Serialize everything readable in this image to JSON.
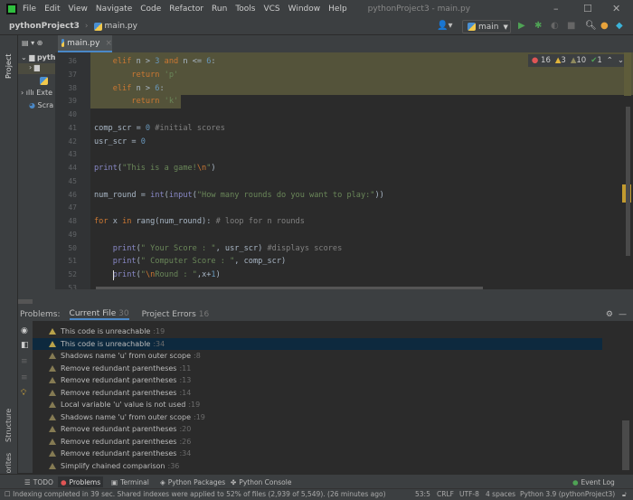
{
  "menu": [
    "File",
    "Edit",
    "View",
    "Navigate",
    "Code",
    "Refactor",
    "Run",
    "Tools",
    "VCS",
    "Window",
    "Help"
  ],
  "window_title": "pythonProject3 - main.py",
  "breadcrumb": {
    "project": "pythonProject3",
    "file": "main.py"
  },
  "run_config": "main",
  "project_pane": {
    "label": "Project",
    "items": [
      "pyth",
      "",
      "",
      "Exte",
      "Scra"
    ]
  },
  "editor_tab": "main.py",
  "inspections": {
    "errors": "16",
    "warnings": "3",
    "weak_warnings": "10",
    "ok": "1"
  },
  "code": [
    {
      "n": "36",
      "t": [
        [
          "    ",
          ""
        ],
        [
          "elif",
          "kw"
        ],
        [
          " n > ",
          ""
        ],
        [
          "3",
          "num"
        ],
        [
          " ",
          ""
        ],
        [
          "and",
          "kw"
        ],
        [
          " n <= ",
          ""
        ],
        [
          "6",
          "num"
        ],
        [
          ":",
          ""
        ]
      ]
    },
    {
      "n": "37",
      "t": [
        [
          "        ",
          ""
        ],
        [
          "return",
          "kw"
        ],
        [
          " ",
          ""
        ],
        [
          "'p'",
          "str"
        ]
      ]
    },
    {
      "n": "38",
      "t": [
        [
          "    ",
          ""
        ],
        [
          "elif",
          "kw"
        ],
        [
          " n > ",
          ""
        ],
        [
          "6",
          "num"
        ],
        [
          ":",
          ""
        ]
      ]
    },
    {
      "n": "39",
      "t": [
        [
          "        ",
          ""
        ],
        [
          "return",
          "kw"
        ],
        [
          " ",
          ""
        ],
        [
          "'k'",
          "str"
        ]
      ]
    },
    {
      "n": "40",
      "t": []
    },
    {
      "n": "41",
      "t": [
        [
          "comp_scr = ",
          ""
        ],
        [
          "0",
          "num"
        ],
        [
          " #initial scores",
          "cm"
        ]
      ]
    },
    {
      "n": "42",
      "t": [
        [
          "usr_scr = ",
          ""
        ],
        [
          "0",
          "num"
        ]
      ]
    },
    {
      "n": "43",
      "t": []
    },
    {
      "n": "44",
      "t": [
        [
          "print",
          "fn"
        ],
        [
          "(",
          ""
        ],
        [
          "\"This is a game!",
          "str"
        ],
        [
          "\\n",
          "esc"
        ],
        [
          "\"",
          "str"
        ],
        [
          ")",
          ""
        ]
      ]
    },
    {
      "n": "45",
      "t": []
    },
    {
      "n": "46",
      "t": [
        [
          "num_round = ",
          ""
        ],
        [
          "int",
          "fn"
        ],
        [
          "(",
          ""
        ],
        [
          "input",
          "fn"
        ],
        [
          "(",
          ""
        ],
        [
          "\"How many rounds do you want to play:\"",
          "str"
        ],
        [
          "))",
          ""
        ]
      ]
    },
    {
      "n": "47",
      "t": []
    },
    {
      "n": "48",
      "t": [
        [
          "for",
          "kw"
        ],
        [
          " x ",
          ""
        ],
        [
          "in",
          "kw"
        ],
        [
          " rang(num_round): ",
          ""
        ],
        [
          "# loop for n rounds",
          "cm"
        ]
      ]
    },
    {
      "n": "49",
      "t": []
    },
    {
      "n": "50",
      "t": [
        [
          "    ",
          ""
        ],
        [
          "print",
          "fn"
        ],
        [
          "(",
          ""
        ],
        [
          "\" Your Score : \"",
          "str"
        ],
        [
          ", usr_scr) ",
          ""
        ],
        [
          "#displays scores",
          "cm"
        ]
      ]
    },
    {
      "n": "51",
      "t": [
        [
          "    ",
          ""
        ],
        [
          "print",
          "fn"
        ],
        [
          "(",
          ""
        ],
        [
          "\" Computer Score : \"",
          "str"
        ],
        [
          ", comp_scr)",
          ""
        ]
      ]
    },
    {
      "n": "52",
      "t": [
        [
          "    ",
          ""
        ],
        [
          "print",
          "fn"
        ],
        [
          "(",
          ""
        ],
        [
          "\"",
          "str"
        ],
        [
          "\\n",
          "esc"
        ],
        [
          "Round : \"",
          "str"
        ],
        [
          ",x+",
          ""
        ],
        [
          "1",
          "num"
        ],
        [
          ")",
          ""
        ]
      ]
    },
    {
      "n": "53",
      "t": []
    }
  ],
  "problems": {
    "label": "Problems:",
    "tabs": [
      {
        "label": "Current File",
        "count": "30"
      },
      {
        "label": "Project Errors",
        "count": "16"
      }
    ],
    "items": [
      {
        "text": "This code is unreachable",
        "line": ":19"
      },
      {
        "text": "This code is unreachable",
        "line": ":34"
      },
      {
        "text": "Shadows name 'u' from outer scope",
        "line": ":8"
      },
      {
        "text": "Remove redundant parentheses",
        "line": ":11"
      },
      {
        "text": "Remove redundant parentheses",
        "line": ":13"
      },
      {
        "text": "Remove redundant parentheses",
        "line": ":14"
      },
      {
        "text": "Local variable 'u' value is not used",
        "line": ":19"
      },
      {
        "text": "Shadows name 'u' from outer scope",
        "line": ":19"
      },
      {
        "text": "Remove redundant parentheses",
        "line": ":20"
      },
      {
        "text": "Remove redundant parentheses",
        "line": ":26"
      },
      {
        "text": "Remove redundant parentheses",
        "line": ":34"
      },
      {
        "text": "Simplify chained comparison",
        "line": ":36"
      }
    ]
  },
  "side_labels": {
    "structure": "Structure",
    "favorites": "Favorites"
  },
  "tool_tabs": [
    "TODO",
    "Problems",
    "Terminal",
    "Python Packages",
    "Python Console"
  ],
  "event_log": "Event Log",
  "status": {
    "message": "Indexing completed in 39 sec. Shared indexes were applied to 52% of files (2,939 of 5,549). (26 minutes ago)",
    "position": "53:5",
    "line_sep": "CRLF",
    "encoding": "UTF-8",
    "indent": "4 spaces",
    "interpreter": "Python 3.9 (pythonProject3)"
  }
}
